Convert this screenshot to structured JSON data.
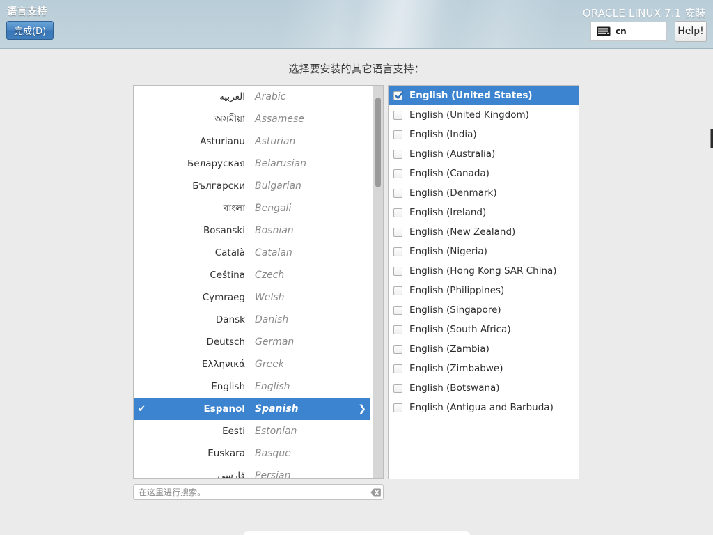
{
  "header": {
    "page_title": "语言支持",
    "done_label": "完成(D)",
    "product_name": "ORACLE LINUX 7.1 安装",
    "keyboard_layout": "cn",
    "keyboard_icon": "keyboard-icon",
    "help_label": "Help!",
    "accent_color": "#3c84d0",
    "header_bg_color": "#bdd0da"
  },
  "main": {
    "heading": "选择要安装的其它语言支持："
  },
  "language_list": {
    "selected_index": 14,
    "items": [
      {
        "native": "العربية",
        "english": "Arabic"
      },
      {
        "native": "অসমীয়া",
        "english": "Assamese"
      },
      {
        "native": "Asturianu",
        "english": "Asturian"
      },
      {
        "native": "Беларуская",
        "english": "Belarusian"
      },
      {
        "native": "Български",
        "english": "Bulgarian"
      },
      {
        "native": "বাংলা",
        "english": "Bengali"
      },
      {
        "native": "Bosanski",
        "english": "Bosnian"
      },
      {
        "native": "Català",
        "english": "Catalan"
      },
      {
        "native": "Čeština",
        "english": "Czech"
      },
      {
        "native": "Cymraeg",
        "english": "Welsh"
      },
      {
        "native": "Dansk",
        "english": "Danish"
      },
      {
        "native": "Deutsch",
        "english": "German"
      },
      {
        "native": "Ελληνικά",
        "english": "Greek"
      },
      {
        "native": "English",
        "english": "English"
      },
      {
        "native": "Español",
        "english": "Spanish"
      },
      {
        "native": "Eesti",
        "english": "Estonian"
      },
      {
        "native": "Euskara",
        "english": "Basque"
      },
      {
        "native": "فارسی",
        "english": "Persian"
      }
    ],
    "selected_native": "English",
    "check_glyph": "✔",
    "chevron_glyph": "❯"
  },
  "locale_list": {
    "selected_index": 0,
    "items": [
      "English (United States)",
      "English (United Kingdom)",
      "English (India)",
      "English (Australia)",
      "English (Canada)",
      "English (Denmark)",
      "English (Ireland)",
      "English (New Zealand)",
      "English (Nigeria)",
      "English (Hong Kong SAR China)",
      "English (Philippines)",
      "English (Singapore)",
      "English (South Africa)",
      "English (Zambia)",
      "English (Zimbabwe)",
      "English (Botswana)",
      "English (Antigua and Barbuda)"
    ]
  },
  "search": {
    "value": "",
    "placeholder": "在这里进行搜索。",
    "clear_icon": "clear-backspace-icon"
  },
  "scrollbar": {
    "thumb_top_pct": 3,
    "thumb_height_pct": 23
  }
}
